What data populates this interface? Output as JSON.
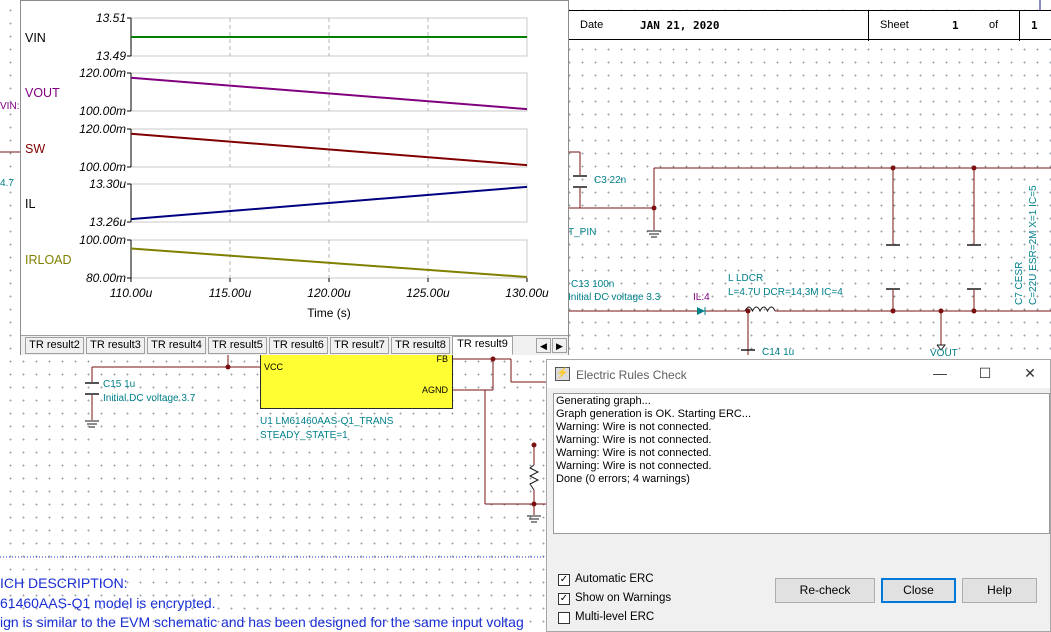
{
  "title_block": {
    "date_label": "Date",
    "date_value": "JAN 21, 2020",
    "sheet_label": "Sheet",
    "sheet_num": "1",
    "of_label": "of",
    "sheet_total": "1"
  },
  "schematic": {
    "labels": {
      "vin_clip": "VIN:",
      "cap_clip": "4.7",
      "c3": "C3 22n",
      "pin_clip": "T_PIN",
      "c13": "C13 100n",
      "c13_ic": "Initial DC voltage 3.3",
      "il4": "IL:4",
      "l_ldcr": "L LDCR",
      "l_params": "L=4.7U DCR=14.3M IC=4",
      "c7": "C7 CESR",
      "c7_params": "C=22U ESR=2M X=1 IC=5",
      "c14": "C14 1u",
      "vout": "VOUT",
      "c15": "C15 1u",
      "c15_ic": "Initial DC voltage 3.7",
      "u1": "U1 LM61460AAS-Q1_TRANS",
      "u1_param": "STEADY_STATE=1"
    },
    "chip": {
      "pin_vcc": "VCC",
      "pin_fb": "FB",
      "pin_agnd": "AGND",
      "fill": "#ffff33"
    },
    "description": [
      "ICH DESCRIPTION:",
      "61460AAS-Q1 model is encrypted.",
      "ign is similar to the EVM schematic and has been designed for the same input voltag"
    ]
  },
  "graph_window": {
    "time_axis": {
      "label": "Time (s)",
      "ticks": [
        "110.00u",
        "115.00u",
        "120.00u",
        "125.00u",
        "130.00u"
      ]
    },
    "tabs": [
      "TR result2",
      "TR result3",
      "TR result4",
      "TR result5",
      "TR result6",
      "TR result7",
      "TR result8",
      "TR result9"
    ],
    "active_tab": "TR result9",
    "scroll_left": "◀",
    "scroll_right": "▶"
  },
  "chart_data": {
    "type": "line",
    "x": {
      "range": [
        110,
        130
      ],
      "unit": "u",
      "label": "Time (s)"
    },
    "panels": [
      {
        "name": "VIN",
        "top_tick": "13.51",
        "bottom_tick": "13.49",
        "ylim": [
          13.49,
          13.51
        ],
        "values": [
          13.5,
          13.5
        ],
        "color": "#008000",
        "label_color": "#000000"
      },
      {
        "name": "VOUT",
        "top_tick": "120.00m",
        "bottom_tick": "100.00m",
        "ylim": [
          100,
          120
        ],
        "values": [
          117.5,
          101.0
        ],
        "color": "#800080",
        "label_color": "#800080"
      },
      {
        "name": "SW",
        "top_tick": "120.00m",
        "bottom_tick": "100.00m",
        "ylim": [
          100,
          120
        ],
        "values": [
          117.5,
          101.0
        ],
        "color": "#800000",
        "label_color": "#800000"
      },
      {
        "name": "IL",
        "top_tick": "13.30u",
        "bottom_tick": "13.26u",
        "ylim": [
          13.26,
          13.3
        ],
        "values": [
          13.263,
          13.297
        ],
        "color": "#000080",
        "label_color": "#000000"
      },
      {
        "name": "IRLOAD",
        "top_tick": "100.00m",
        "bottom_tick": "80.00m",
        "ylim": [
          80,
          100
        ],
        "values": [
          95.5,
          80.5
        ],
        "color": "#808000",
        "label_color": "#808000"
      }
    ]
  },
  "erc_dialog": {
    "title": "Electric Rules Check",
    "log": [
      "Generating graph...",
      "Graph generation is OK. Starting ERC...",
      "Warning: Wire is not connected.",
      "Warning: Wire is not connected.",
      "Warning: Wire is not connected.",
      "Warning: Wire is not connected.",
      "Done (0 errors; 4 warnings)"
    ],
    "options": [
      {
        "label": "Automatic ERC",
        "checked": true
      },
      {
        "label": "Show on Warnings",
        "checked": true
      },
      {
        "label": "Multi-level ERC",
        "checked": false
      }
    ],
    "buttons": {
      "recheck": "Re-check",
      "close": "Close",
      "help": "Help"
    },
    "win_minimize": "—",
    "win_maximize": "☐",
    "win_close": "✕",
    "check_mark": "✓"
  }
}
